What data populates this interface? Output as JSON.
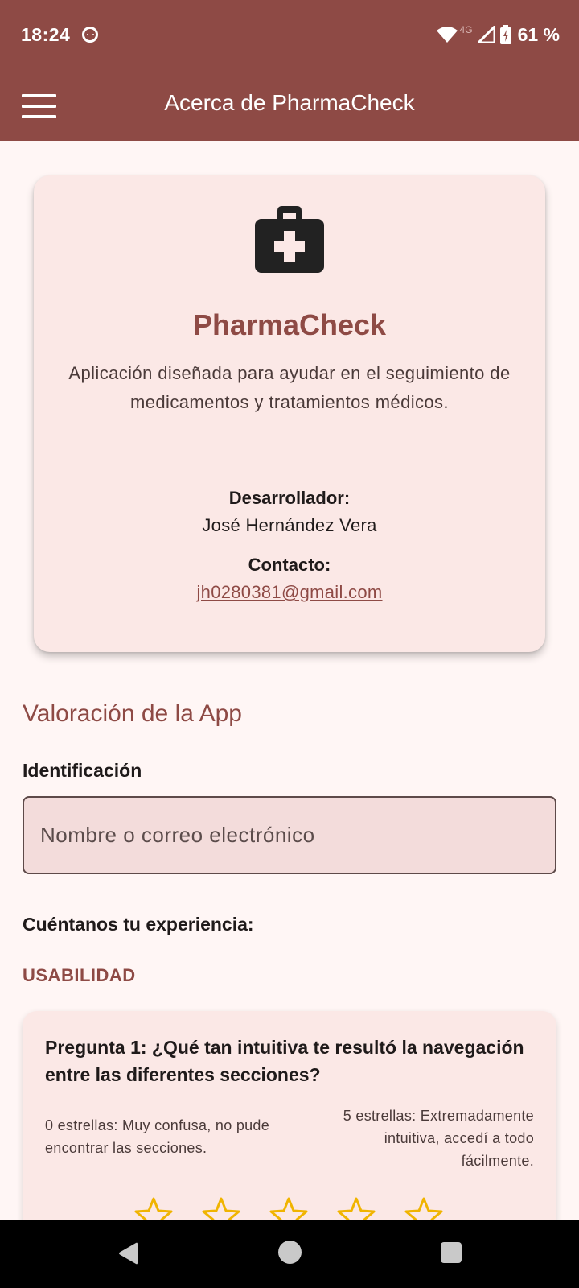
{
  "status_bar": {
    "time": "18:24",
    "network": "4G",
    "battery": "61 %",
    "icons": [
      "notification-face-icon",
      "wifi-icon",
      "signal-icon",
      "battery-charging-icon"
    ]
  },
  "app_bar": {
    "title": "Acerca de PharmaCheck",
    "menu_icon": "menu-icon"
  },
  "about": {
    "icon": "medical-kit-icon",
    "app_name": "PharmaCheck",
    "description": "Aplicación diseñada para ayudar en el seguimiento de medicamentos y tratamientos médicos.",
    "developer_label": "Desarrollador:",
    "developer_name": "José Hernández Vera",
    "contact_label": "Contacto:",
    "contact_email": "jh0280381@gmail.com"
  },
  "rating": {
    "section_title": "Valoración de la App",
    "identification_label": "Identificación",
    "identification_placeholder": "Nombre o correo electrónico",
    "identification_value": "",
    "experience_label": "Cuéntanos tu experiencia:",
    "category": "USABILIDAD",
    "questions": [
      {
        "text": "Pregunta 1: ¿Qué tan intuitiva te resultó la navegación entre las diferentes secciones?",
        "scale_min": "0 estrellas: Muy confusa, no pude encontrar las secciones.",
        "scale_max": "5 estrellas: Extremadamente intuitiva, accedí a todo fácilmente.",
        "rating": 0,
        "max_stars": 5
      }
    ]
  },
  "colors": {
    "primary": "#8e4a45",
    "background": "#fff6f5",
    "card": "#fbe8e6",
    "star": "#f0b400"
  },
  "nav_bar": {
    "icons": [
      "back-icon",
      "home-icon",
      "recents-icon"
    ]
  }
}
